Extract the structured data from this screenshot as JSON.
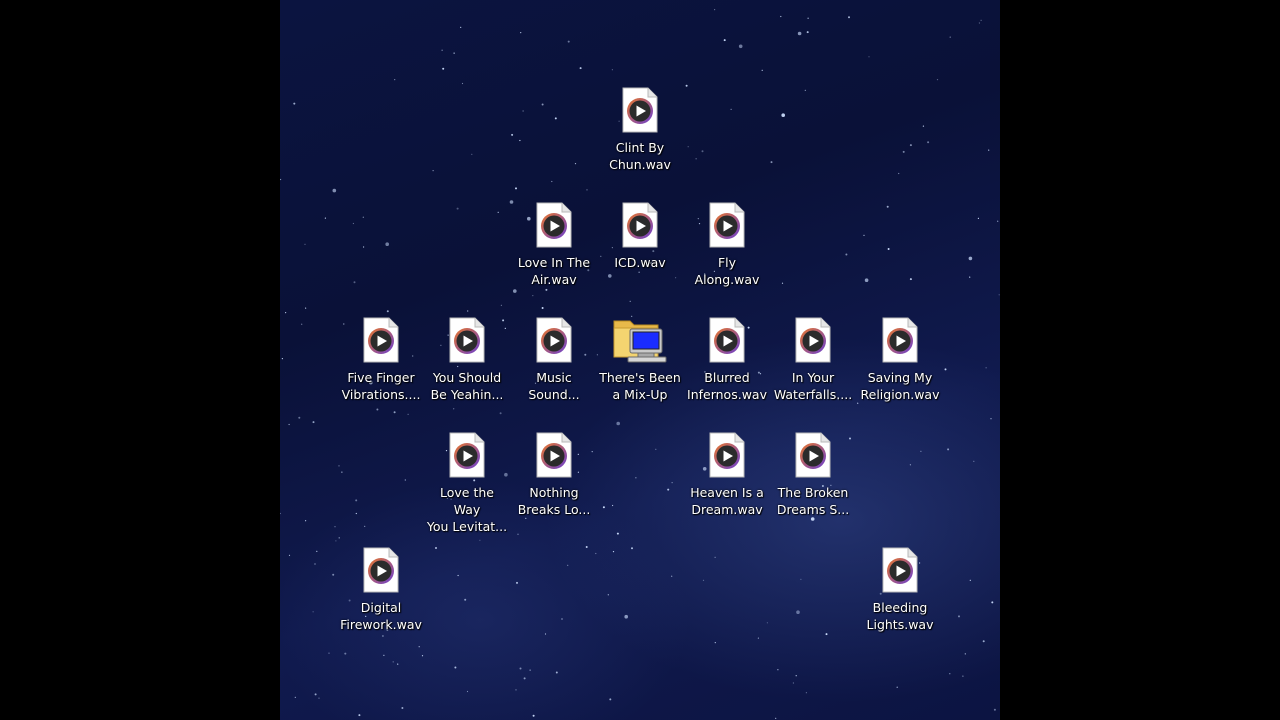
{
  "desktop": {
    "icons": [
      {
        "line1": "Clint By",
        "line2": "Chun.wav",
        "type": "audio"
      },
      {
        "line1": "Love In The",
        "line2": "Air.wav",
        "type": "audio"
      },
      {
        "line1": "ICD.wav",
        "line2": "",
        "type": "audio"
      },
      {
        "line1": "Fly",
        "line2": "Along.wav",
        "type": "audio"
      },
      {
        "line1": "Five Finger",
        "line2": "Vibrations....",
        "type": "audio"
      },
      {
        "line1": "You Should",
        "line2": "Be Yeahin...",
        "type": "audio"
      },
      {
        "line1": "Music",
        "line2": "Sound...",
        "type": "audio"
      },
      {
        "line1": "There's Been",
        "line2": "a Mix-Up",
        "type": "folder"
      },
      {
        "line1": "Blurred",
        "line2": "Infernos.wav",
        "type": "audio"
      },
      {
        "line1": "In Your",
        "line2": "Waterfalls....",
        "type": "audio"
      },
      {
        "line1": "Saving My",
        "line2": "Religion.wav",
        "type": "audio"
      },
      {
        "line1": "Love the Way",
        "line2": "You Levitat...",
        "type": "audio"
      },
      {
        "line1": "Nothing",
        "line2": "Breaks Lo...",
        "type": "audio"
      },
      {
        "line1": "Heaven Is a",
        "line2": "Dream.wav",
        "type": "audio"
      },
      {
        "line1": "The Broken",
        "line2": "Dreams S...",
        "type": "audio"
      },
      {
        "line1": "Digital",
        "line2": "Firework.wav",
        "type": "audio"
      },
      {
        "line1": "Bleeding",
        "line2": "Lights.wav",
        "type": "audio"
      }
    ],
    "icon_names": {
      "audio": "audio-file-icon",
      "folder": "computer-folder-icon"
    }
  },
  "colors": {
    "play_ring_orange": "#e8762c",
    "play_ring_purple": "#6a3fd0",
    "play_disc": "#2b2b2b",
    "folder_yellow": "#f4d470",
    "monitor_blue": "#1a2cff"
  }
}
